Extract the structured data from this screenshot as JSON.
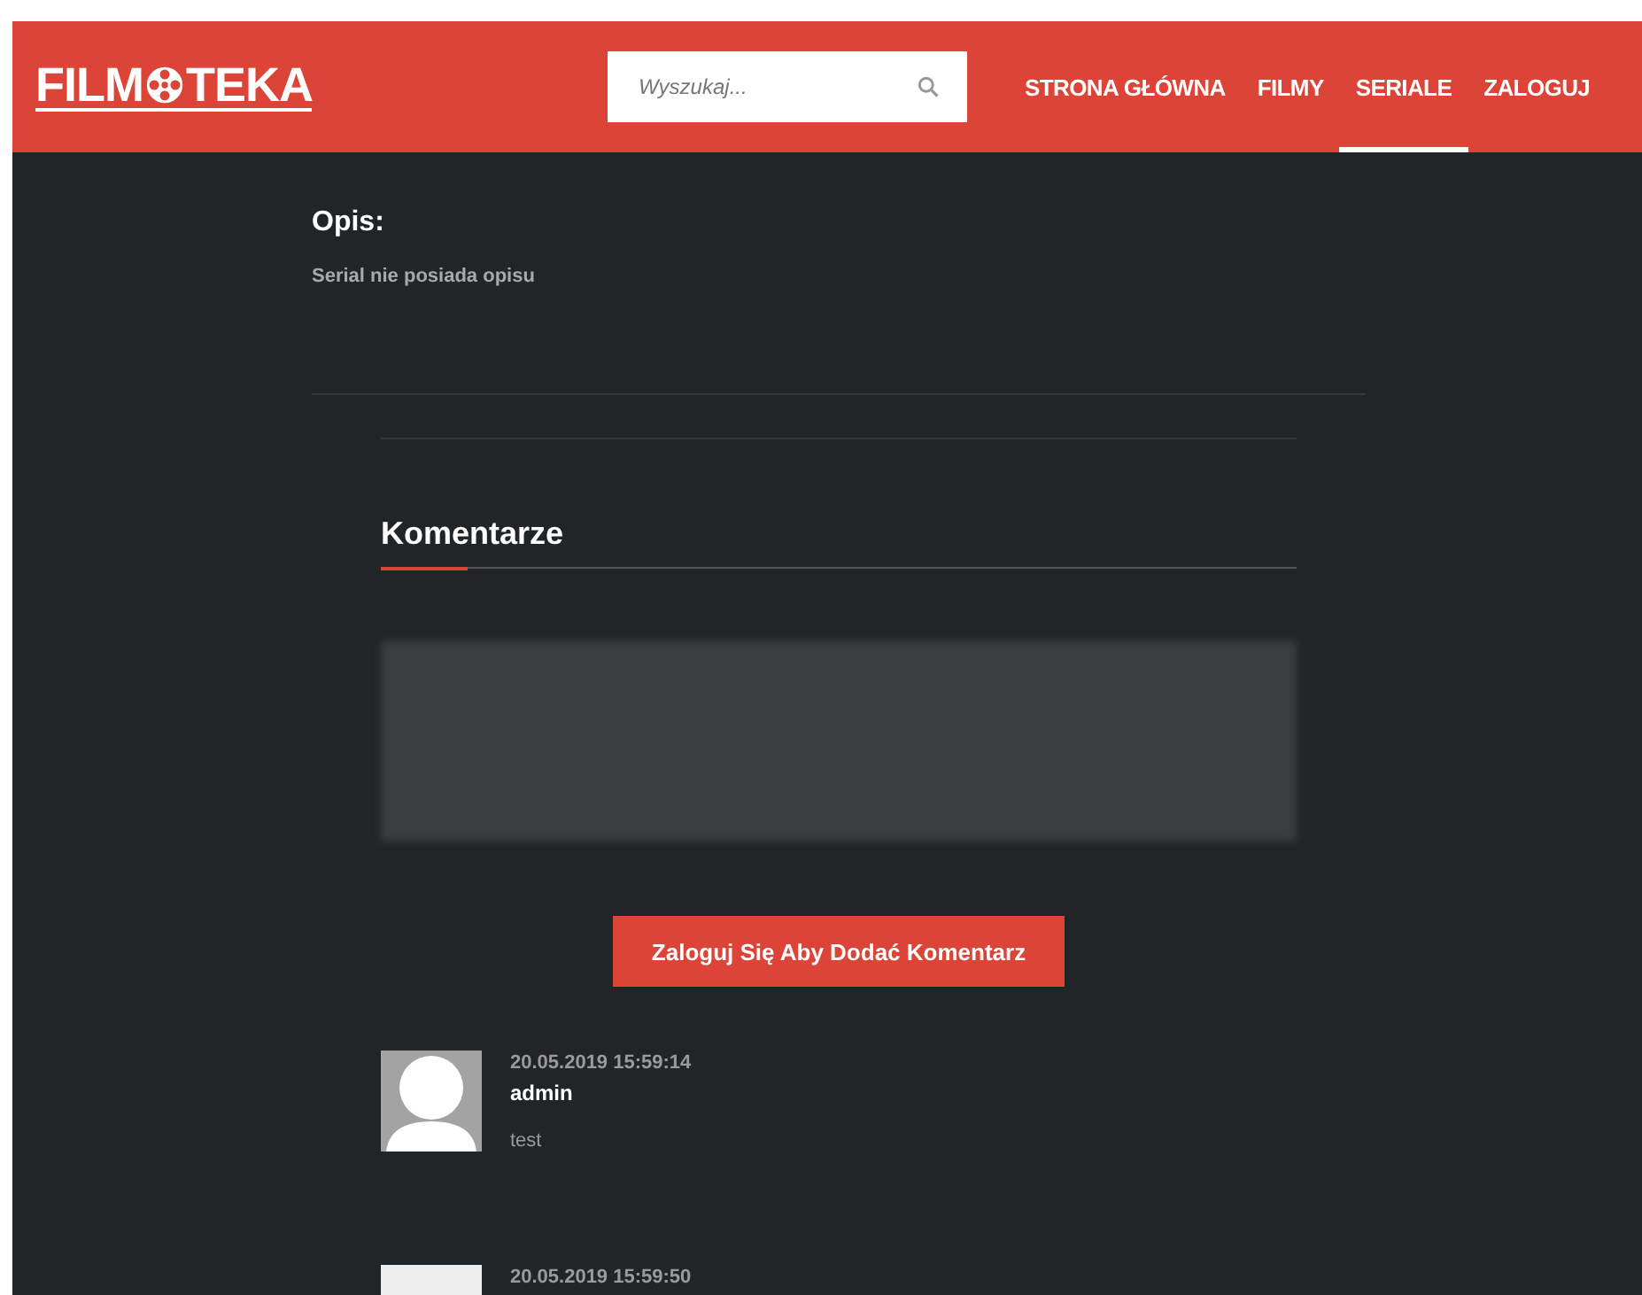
{
  "header": {
    "logo": {
      "before": "FILM",
      "after": "TEKA"
    },
    "search": {
      "placeholder": "Wyszukaj..."
    },
    "nav": [
      {
        "label": "STRONA GŁÓWNA",
        "selected": false
      },
      {
        "label": "FILMY",
        "selected": false
      },
      {
        "label": "SERIALE",
        "selected": true
      },
      {
        "label": "ZALOGUJ",
        "selected": false
      }
    ]
  },
  "description": {
    "title": "Opis:",
    "text": "Serial nie posiada opisu"
  },
  "comments": {
    "title": "Komentarze",
    "textarea": {
      "disabled": true
    },
    "login_button": "Zaloguj Się Aby Dodać Komentarz",
    "items": [
      {
        "kind": "silhouette",
        "timestamp": "20.05.2019 15:59:14",
        "author": "admin",
        "text": "test"
      },
      {
        "kind": "picture",
        "timestamp": "20.05.2019 15:59:50"
      }
    ]
  }
}
